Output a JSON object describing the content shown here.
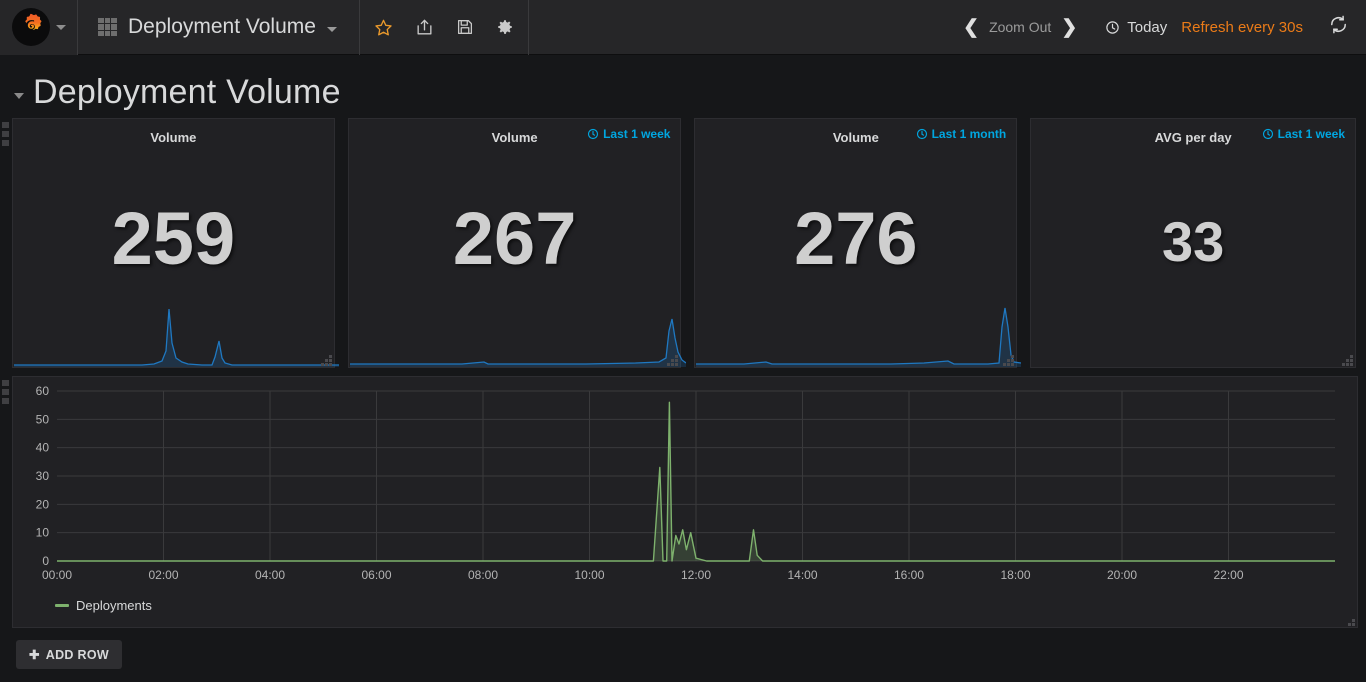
{
  "app": {
    "logo_name": "grafana-logo",
    "accent_orange": "#eb7b18",
    "accent_blue": "#00a6e0",
    "series_green": "#7eb26d",
    "spark_blue": "#1f78c1"
  },
  "topnav": {
    "dashboard_title": "Deployment Volume",
    "icons": {
      "star": "star-icon",
      "share": "share-icon",
      "save": "save-icon",
      "settings": "gear-icon",
      "refresh": "refresh-icon"
    },
    "zoom_out_label": "Zoom Out",
    "time_range_label": "Today",
    "refresh_label": "Refresh every 30s"
  },
  "row_header": {
    "title": "Deployment Volume"
  },
  "panels": [
    {
      "title": "Volume",
      "value": "259",
      "time_override": null,
      "value_size": 74,
      "has_sparkline": true
    },
    {
      "title": "Volume",
      "value": "267",
      "time_override": "Last 1 week",
      "value_size": 74,
      "has_sparkline": true
    },
    {
      "title": "Volume",
      "value": "276",
      "time_override": "Last 1 month",
      "value_size": 74,
      "has_sparkline": true
    },
    {
      "title": "AVG per day",
      "value": "33",
      "time_override": "Last 1 week",
      "value_size": 56,
      "has_sparkline": false
    }
  ],
  "chart_data": {
    "type": "line",
    "title": "",
    "xlabel": "",
    "ylabel": "",
    "ylim": [
      0,
      60
    ],
    "yticks": [
      0,
      10,
      20,
      30,
      40,
      50,
      60
    ],
    "xticks": [
      "00:00",
      "02:00",
      "04:00",
      "06:00",
      "08:00",
      "10:00",
      "12:00",
      "14:00",
      "16:00",
      "18:00",
      "20:00",
      "22:00"
    ],
    "xlim_hours": [
      0,
      24
    ],
    "grid": true,
    "legend_position": "bottom-left",
    "series": [
      {
        "name": "Deployments",
        "color": "#7eb26d",
        "fill": true,
        "points_hours": [
          0,
          11.2,
          11.32,
          11.38,
          11.45,
          11.5,
          11.55,
          11.62,
          11.68,
          11.75,
          11.82,
          11.9,
          12.0,
          12.2,
          13.0,
          13.08,
          13.15,
          13.25,
          24
        ],
        "points_values": [
          0,
          0,
          33,
          0,
          0,
          56,
          0,
          9,
          6,
          11,
          4,
          10,
          1,
          0,
          0,
          11,
          2,
          0,
          0
        ]
      }
    ]
  },
  "legend": {
    "series_label": "Deployments"
  },
  "footer": {
    "add_row_label": "ADD ROW",
    "add_row_icon": "plus-icon"
  },
  "sparklines": [
    {
      "points": [
        [
          0,
          0
        ],
        [
          40,
          0
        ],
        [
          44,
          1
        ],
        [
          46,
          4
        ],
        [
          47,
          16
        ],
        [
          48,
          60
        ],
        [
          49,
          22
        ],
        [
          50,
          7
        ],
        [
          52,
          3
        ],
        [
          54,
          1
        ],
        [
          58,
          0
        ],
        [
          61,
          0
        ],
        [
          62,
          10
        ],
        [
          63,
          22
        ],
        [
          64,
          8
        ],
        [
          65,
          2
        ],
        [
          67,
          0
        ],
        [
          100,
          0
        ]
      ]
    },
    {
      "points": [
        [
          0,
          1
        ],
        [
          20,
          1
        ],
        [
          33,
          1
        ],
        [
          40,
          3
        ],
        [
          41,
          1
        ],
        [
          55,
          1
        ],
        [
          70,
          1
        ],
        [
          85,
          2
        ],
        [
          92,
          3
        ],
        [
          94,
          10
        ],
        [
          95,
          55
        ],
        [
          96,
          75
        ],
        [
          97,
          40
        ],
        [
          98,
          18
        ],
        [
          99,
          7
        ],
        [
          100,
          3
        ]
      ]
    },
    {
      "points": [
        [
          0,
          1
        ],
        [
          15,
          1
        ],
        [
          22,
          3
        ],
        [
          24,
          1
        ],
        [
          40,
          1
        ],
        [
          60,
          1
        ],
        [
          70,
          2
        ],
        [
          78,
          4
        ],
        [
          80,
          1
        ],
        [
          90,
          1
        ],
        [
          93,
          2
        ],
        [
          94,
          70
        ],
        [
          95,
          96
        ],
        [
          96,
          70
        ],
        [
          97,
          20
        ],
        [
          98,
          5
        ],
        [
          100,
          2
        ]
      ]
    }
  ]
}
